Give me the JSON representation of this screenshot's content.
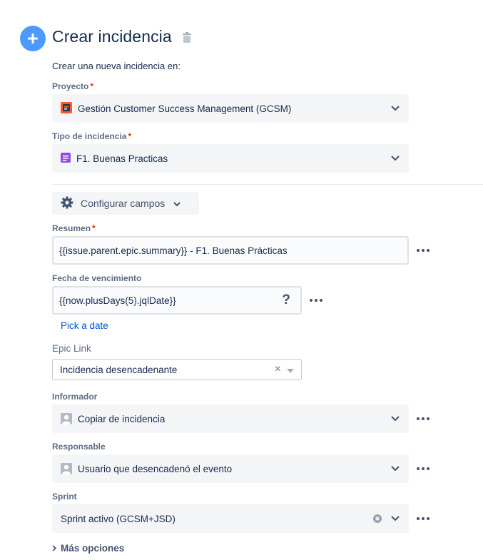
{
  "header": {
    "title": "Crear incidencia",
    "subtitle": "Crear una nueva incidencia en:"
  },
  "fields": {
    "project": {
      "label": "Proyecto",
      "required": "*",
      "value": "Gestión Customer Success Management (GCSM)",
      "icon": "project-avatar-icon"
    },
    "issue_type": {
      "label": "Tipo de incidencia",
      "required": "*",
      "value": "F1. Buenas Practicas",
      "icon": "issue-type-icon"
    },
    "summary": {
      "label": "Resumen",
      "required": "*",
      "value": "{{issue.parent.epic.summary}} - F1. Buenas Prácticas"
    },
    "due_date": {
      "label": "Fecha de vencimiento",
      "value": "{{now.plusDays(5).jqlDate}}",
      "help": "?",
      "link": "Pick a date"
    },
    "epic_link": {
      "label": "Epic Link",
      "value": "Incidencia desencadenante",
      "clear": "×"
    },
    "reporter": {
      "label": "Informador",
      "value": "Copiar de incidencia"
    },
    "assignee": {
      "label": "Responsable",
      "value": "Usuario que desencadenó el evento"
    },
    "sprint": {
      "label": "Sprint",
      "value": "Sprint activo (GCSM+JSD)"
    }
  },
  "config_button": {
    "label": "Configurar campos"
  },
  "more_options": {
    "label": "Más opciones"
  },
  "colors": {
    "accent": "#4c9aff",
    "link": "#0052cc",
    "required": "#de350b",
    "issue_type": "#904ee2",
    "project": "#ff5630"
  }
}
